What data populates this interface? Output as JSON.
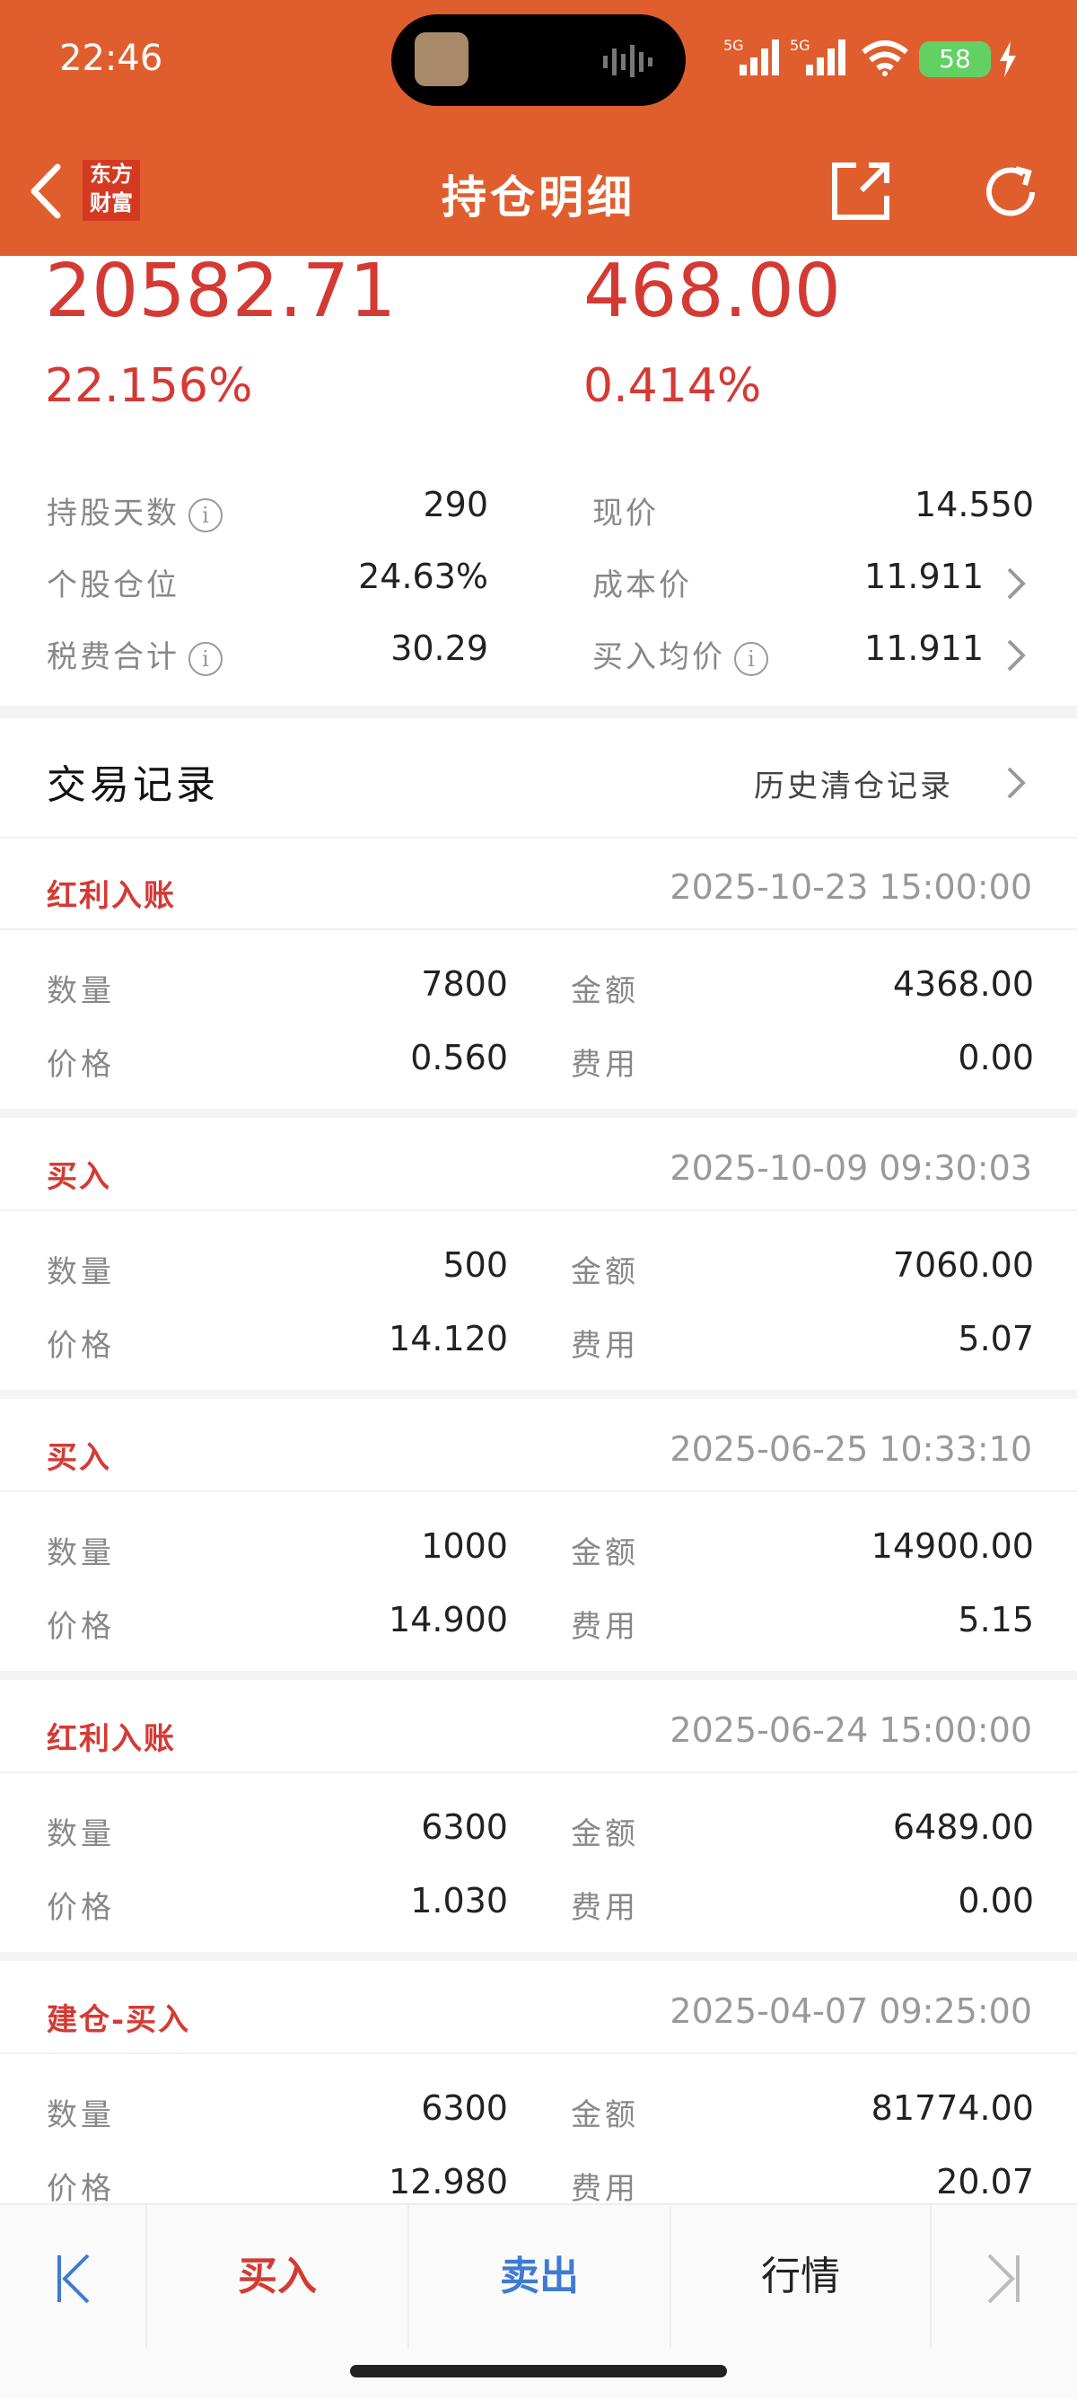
{
  "status_bar": {
    "time": "22:46",
    "battery": "58"
  },
  "header": {
    "title": "持仓明细",
    "logo_line1": "东方",
    "logo_line2": "财富"
  },
  "summary": {
    "left_amount": "20582.71",
    "left_pct": "22.156%",
    "right_amount": "468.00",
    "right_pct": "0.414%"
  },
  "info": {
    "hold_days_label": "持股天数",
    "hold_days": "290",
    "current_price_label": "现价",
    "current_price": "14.550",
    "position_label": "个股仓位",
    "position": "24.63%",
    "cost_price_label": "成本价",
    "cost_price": "11.911",
    "tax_label": "税费合计",
    "tax": "30.29",
    "avg_buy_label": "买入均价",
    "avg_buy": "11.911",
    "info_glyph": "i"
  },
  "trades": {
    "title": "交易记录",
    "history_link": "历史清仓记录",
    "labels": {
      "qty": "数量",
      "amount": "金额",
      "price": "价格",
      "fee": "费用"
    },
    "records": [
      {
        "type": "红利入账",
        "datetime": "2025-10-23 15:00:00",
        "qty": "7800",
        "amount": "4368.00",
        "price": "0.560",
        "fee": "0.00"
      },
      {
        "type": "买入",
        "datetime": "2025-10-09 09:30:03",
        "qty": "500",
        "amount": "7060.00",
        "price": "14.120",
        "fee": "5.07"
      },
      {
        "type": "买入",
        "datetime": "2025-06-25 10:33:10",
        "qty": "1000",
        "amount": "14900.00",
        "price": "14.900",
        "fee": "5.15"
      },
      {
        "type": "红利入账",
        "datetime": "2025-06-24 15:00:00",
        "qty": "6300",
        "amount": "6489.00",
        "price": "1.030",
        "fee": "0.00"
      },
      {
        "type": "建仓-买入",
        "datetime": "2025-04-07 09:25:00",
        "qty": "6300",
        "amount": "81774.00",
        "price": "12.980",
        "fee": "20.07"
      }
    ]
  },
  "bottom_bar": {
    "buy": "买入",
    "sell": "卖出",
    "market": "行情"
  },
  "colors": {
    "header": "#E05E2D",
    "accent_red": "#D43A34",
    "sell_blue": "#3F7BD0"
  }
}
